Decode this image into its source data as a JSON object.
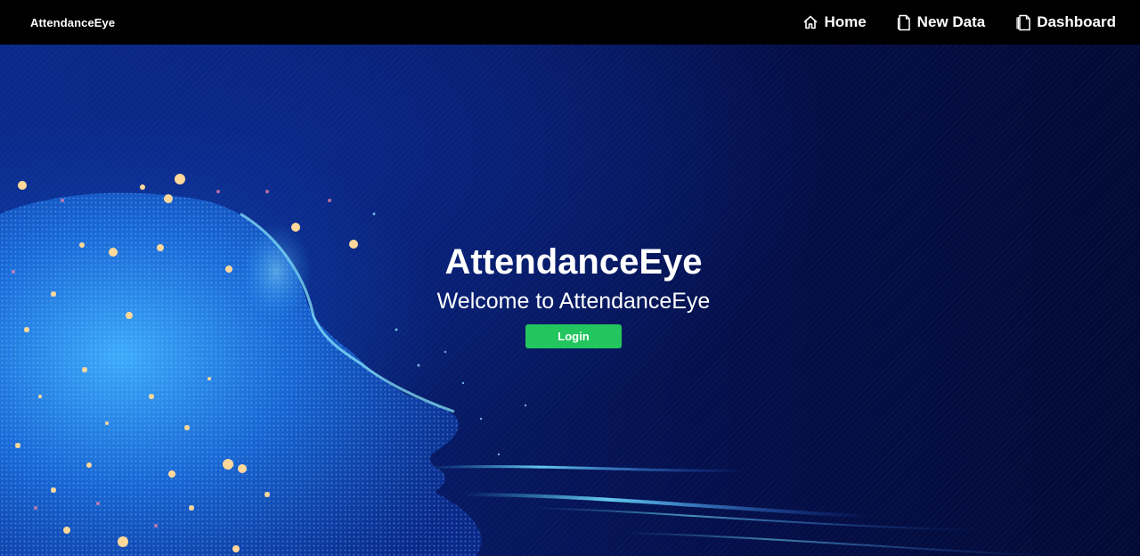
{
  "navbar": {
    "brand": "AttendanceEye",
    "links": [
      {
        "label": "Home",
        "icon": "home-icon"
      },
      {
        "label": "New Data",
        "icon": "document-icon"
      },
      {
        "label": "Dashboard",
        "icon": "documents-icon"
      }
    ]
  },
  "hero": {
    "title": "AttendanceEye",
    "subtitle": "Welcome to AttendanceEye",
    "login_label": "Login",
    "background_image": "digital-face-particles-image"
  },
  "colors": {
    "navbar_bg": "#000000",
    "hero_bg": "#061a66",
    "login_button": "#22c55e",
    "text": "#ffffff"
  }
}
